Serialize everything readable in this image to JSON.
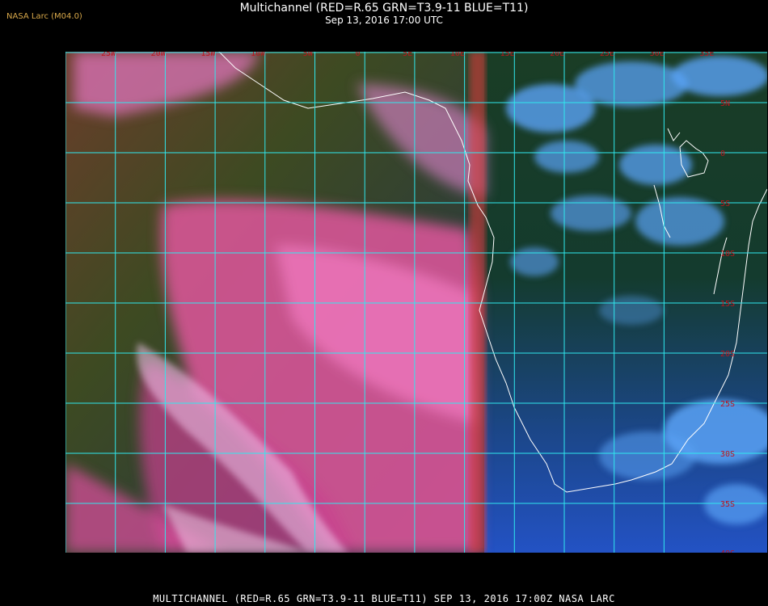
{
  "header": {
    "watermark": "NASA Larc (M04.0)",
    "title": "Multichannel (RED=R.65 GRN=T3.9-11 BLUE=T11)",
    "subtitle": "Sep 13, 2016 17:00 UTC"
  },
  "footer": {
    "caption": "MULTICHANNEL (RED=R.65 GRN=T3.9-11 BLUE=T11) SEP 13, 2016 17:00Z   NASA LARC"
  },
  "grid": {
    "longitude_labels": [
      "25W",
      "20W",
      "15W",
      "10W",
      "5W",
      "0",
      "5E",
      "10E",
      "15E",
      "20E",
      "25E",
      "30E",
      "35E"
    ],
    "latitude_labels": [
      "5N",
      "0",
      "5S",
      "10S",
      "15S",
      "20S",
      "25S",
      "30S",
      "35S",
      "40S"
    ]
  },
  "colors": {
    "grid": "#30e8ee",
    "grid_label": "#c0141c",
    "coastline": "#ffffff",
    "ocean_cloud_pink": "#e85aa8",
    "ocean_dark": "#2f3e1e",
    "land_blue": "#2046b8",
    "cloud_cyan": "#5aa2f6"
  }
}
